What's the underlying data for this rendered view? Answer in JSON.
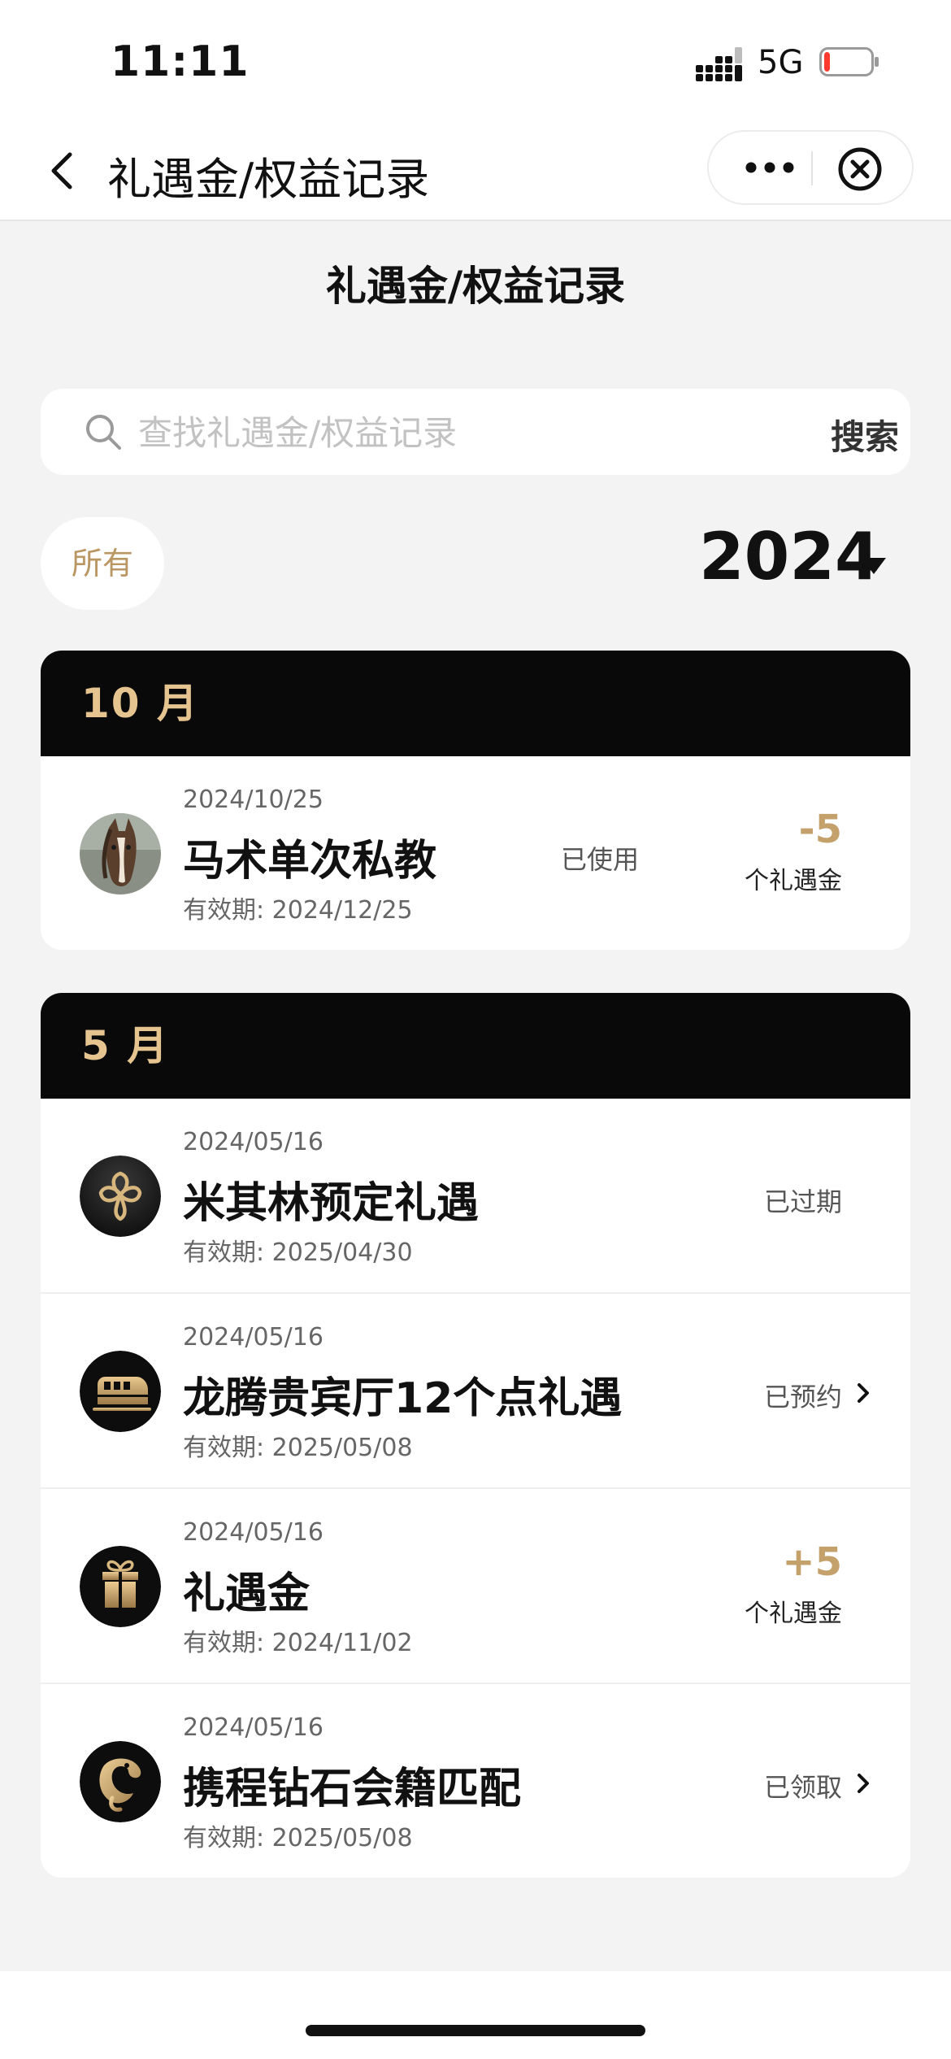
{
  "status_bar": {
    "time": "11:11",
    "network": "5G",
    "battery_level": 0.12,
    "battery_color": "#ff3b30"
  },
  "navbar": {
    "title": "礼遇金/权益记录",
    "back_icon": "chevron-left-icon",
    "more_icon": "more-dots-icon",
    "close_icon": "close-circle-icon"
  },
  "page_title": "礼遇金/权益记录",
  "search": {
    "placeholder": "查找礼遇金/权益记录",
    "button_label": "搜索"
  },
  "filter": {
    "all_label": "所有",
    "year": "2024"
  },
  "colors": {
    "accent_gold": "#c4a06a",
    "month_header_bg": "#090909",
    "month_header_text": "#e6c48f",
    "page_bg": "#f3f3f3"
  },
  "months": [
    {
      "label": "10 月",
      "records": [
        {
          "date": "2024/10/25",
          "name": "马术单次私教",
          "validity": "有效期: 2024/12/25",
          "status": "已使用",
          "amount": "-5",
          "unit": "个礼遇金",
          "icon": "horse-photo"
        }
      ]
    },
    {
      "label": "5 月",
      "records": [
        {
          "date": "2024/05/16",
          "name": "米其林预定礼遇",
          "validity": "有效期: 2025/04/30",
          "status": "已过期",
          "icon": "michelin-flower-icon"
        },
        {
          "date": "2024/05/16",
          "name": "龙腾贵宾厅12个点礼遇",
          "validity": "有效期: 2025/05/08",
          "status": "已预约",
          "icon": "train-icon"
        },
        {
          "date": "2024/05/16",
          "name": "礼遇金",
          "validity": "有效期: 2024/11/02",
          "amount": "+5",
          "unit": "个礼遇金",
          "icon": "gift-box-icon"
        },
        {
          "date": "2024/05/16",
          "name": "携程钻石会籍匹配",
          "validity": "有效期: 2025/05/08",
          "status": "已领取",
          "icon": "dolphin-logo-icon"
        }
      ]
    }
  ]
}
